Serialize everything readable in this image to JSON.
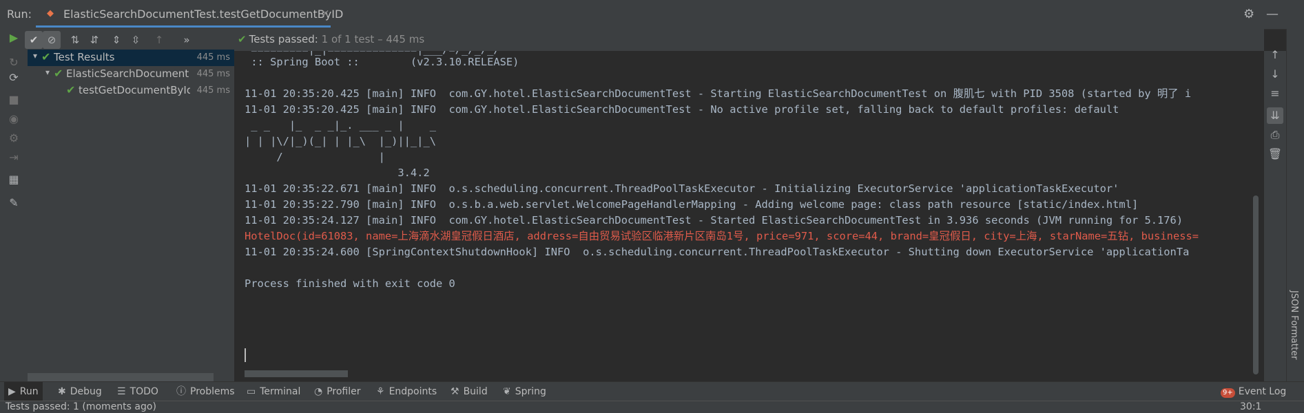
{
  "window": {
    "run_label": "Run:",
    "tab_title": "ElasticSearchDocumentTest.testGetDocumentByID",
    "tab_close": "×"
  },
  "toolbar": {
    "status_label": "Tests passed:",
    "status_detail": "1 of 1 test – 445 ms",
    "more": "»"
  },
  "tree": {
    "rows": [
      {
        "name": "Test Results",
        "time": "445 ms"
      },
      {
        "name": "ElasticSearchDocument",
        "time": "445 ms"
      },
      {
        "name": "testGetDocumentById",
        "time": "445 ms"
      }
    ]
  },
  "console": {
    "lines": [
      " =========|_|==============|___/=/_/_/_/",
      " :: Spring Boot ::        (v2.3.10.RELEASE)",
      "",
      "11-01 20:35:20.425 [main] INFO  com.GY.hotel.ElasticSearchDocumentTest - Starting ElasticSearchDocumentTest on 腹肌七 with PID 3508 (started by 明了 i",
      "11-01 20:35:20.425 [main] INFO  com.GY.hotel.ElasticSearchDocumentTest - No active profile set, falling back to default profiles: default",
      " _ _   |_  _ _|_. ___ _ |    _",
      "| | |\\/|_)(_| | |_\\  |_)||_|_\\",
      "     /               |",
      "                        3.4.2",
      "11-01 20:35:22.671 [main] INFO  o.s.scheduling.concurrent.ThreadPoolTaskExecutor - Initializing ExecutorService 'applicationTaskExecutor'",
      "11-01 20:35:22.790 [main] INFO  o.s.b.a.web.servlet.WelcomePageHandlerMapping - Adding welcome page: class path resource [static/index.html]",
      "11-01 20:35:24.127 [main] INFO  com.GY.hotel.ElasticSearchDocumentTest - Started ElasticSearchDocumentTest in 3.936 seconds (JVM running for 5.176)",
      "HotelDoc(id=61083, name=上海滴水湖皇冠假日酒店, address=自由贸易试验区临港新片区南岛1号, price=971, score=44, brand=皇冠假日, city=上海, starName=五钻, business=",
      "11-01 20:35:24.600 [SpringContextShutdownHook] INFO  o.s.scheduling.concurrent.ThreadPoolTaskExecutor - Shutting down ExecutorService 'applicationTa",
      "",
      "Process finished with exit code 0"
    ]
  },
  "right_strip": {
    "json_formatter": "JSON Formatter"
  },
  "bottom_tabs": {
    "run": "Run",
    "debug": "Debug",
    "todo": "TODO",
    "problems": "Problems",
    "terminal": "Terminal",
    "profiler": "Profiler",
    "endpoints": "Endpoints",
    "build": "Build",
    "spring": "Spring",
    "event_log": "Event Log",
    "event_badge": "9+"
  },
  "statusbar": {
    "message": "Tests passed: 1 (moments ago)",
    "position": "30:1"
  },
  "colors": {
    "pass_green": "#5fa447",
    "error_red": "#e05b4b",
    "console_text": "#a9b7c6",
    "tab_accent": "#4a88c7"
  }
}
